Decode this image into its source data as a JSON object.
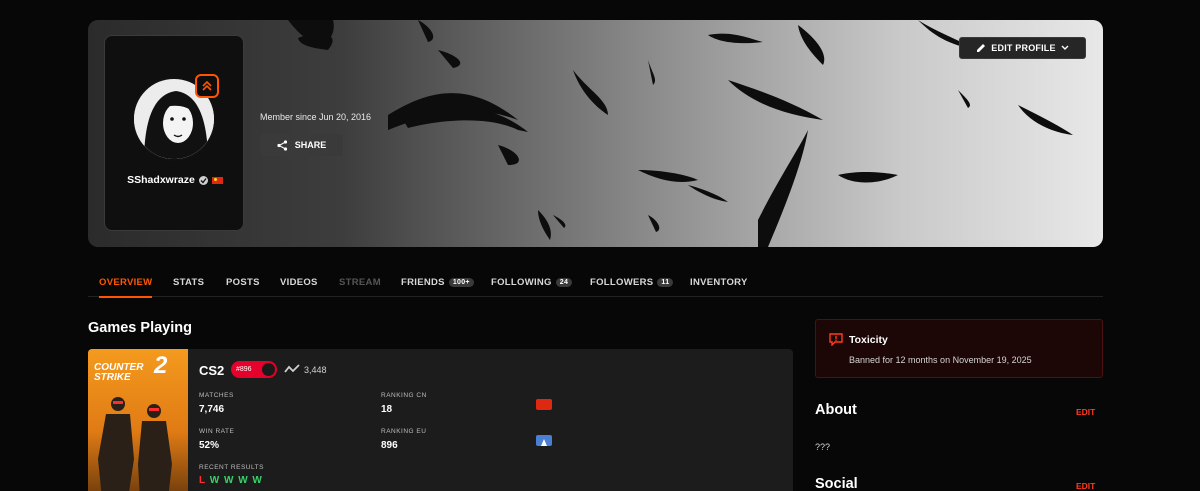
{
  "profile": {
    "username": "SShadxwraze",
    "member_since": "Member since Jun 20, 2016",
    "share_label": "SHARE",
    "edit_profile_label": "EDIT PROFILE"
  },
  "tabs": [
    {
      "label": "OVERVIEW"
    },
    {
      "label": "STATS"
    },
    {
      "label": "POSTS"
    },
    {
      "label": "VIDEOS"
    },
    {
      "label": "STREAM"
    },
    {
      "label": "FRIENDS",
      "count": "100+"
    },
    {
      "label": "FOLLOWING",
      "count": "24"
    },
    {
      "label": "FOLLOWERS",
      "count": "11"
    },
    {
      "label": "INVENTORY"
    }
  ],
  "games": {
    "title": "Games Playing",
    "card": {
      "art_text": {
        "line1": "COUNTER",
        "line2": "STRIKE",
        "num": "2"
      },
      "name": "CS2",
      "elo_badge": "#896",
      "elo": "3,448",
      "matches_label": "MATCHES",
      "matches": "7,746",
      "win_rate_label": "WIN RATE",
      "win_rate": "52%",
      "ranking_cn_label": "RANKING CN",
      "ranking_cn": "18",
      "ranking_eu_label": "RANKING EU",
      "ranking_eu": "896",
      "recent_label": "RECENT RESULTS",
      "recent": [
        "L",
        "W",
        "W",
        "W",
        "W"
      ]
    }
  },
  "toxicity": {
    "title": "Toxicity",
    "text": "Banned for 12 months on November 19, 2025"
  },
  "about": {
    "title": "About",
    "edit": "EDIT",
    "text": "???"
  },
  "social": {
    "title": "Social",
    "edit": "EDIT"
  },
  "colors": {
    "accent": "#ff5500",
    "win": "#38d26a",
    "loss": "#ff2e2e",
    "elo_red": "#e5012b"
  }
}
